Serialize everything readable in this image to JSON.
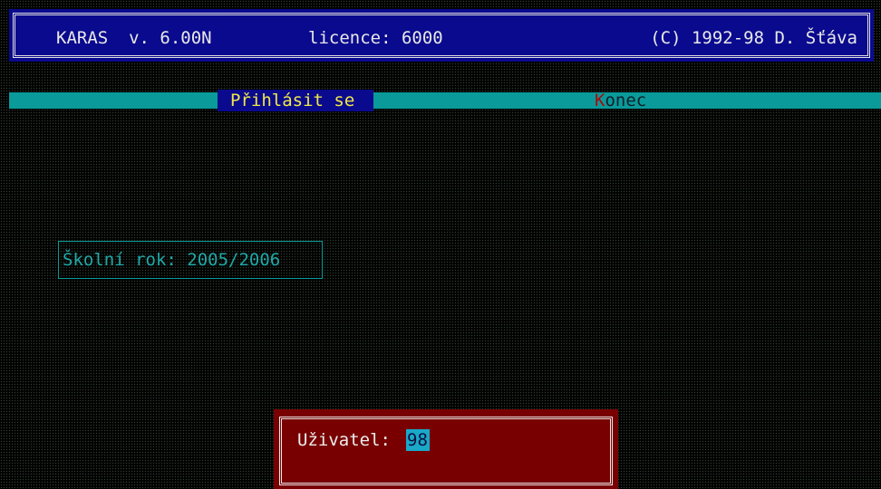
{
  "header": {
    "app_name": "KARAS  v. 6.00N",
    "licence": "licence: 6000",
    "copyright": "(C) 1992-98 D. Šťáva"
  },
  "menu": {
    "login": "Přihlásit se",
    "quit_hotkey": "K",
    "quit_rest": "onec"
  },
  "school_year": "Školní rok: 2005/2006",
  "login_dialog": {
    "label": "Uživatel:",
    "value": "98"
  },
  "colors": {
    "title_bg": "#0a0a8e",
    "menu_bg": "#0a9a9a",
    "dialog_bg": "#780000",
    "input_bg": "#1aa8c8"
  }
}
